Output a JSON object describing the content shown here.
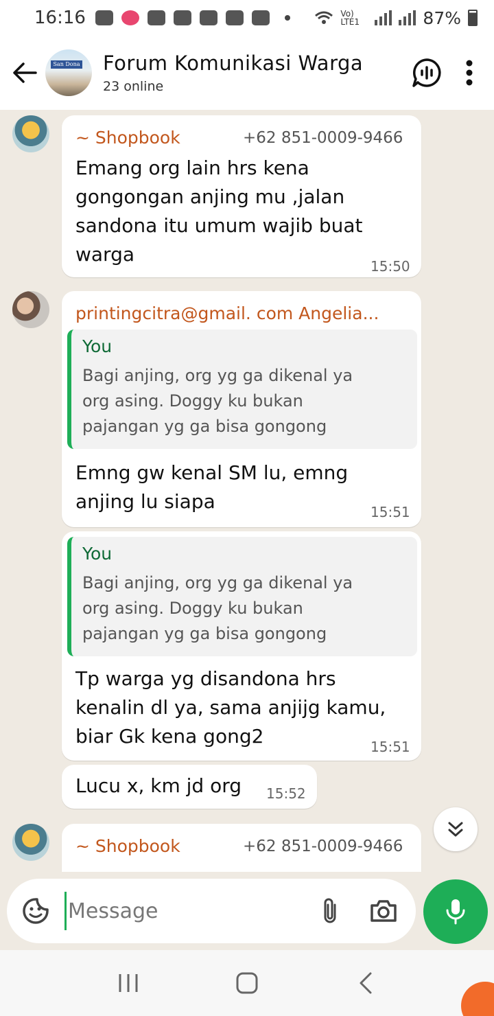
{
  "status_bar": {
    "time": "16:16",
    "network_label": "Vo) LTE1",
    "battery_percent": "87%"
  },
  "header": {
    "title": "Forum Komunikasi Warga",
    "subtitle": "23 online",
    "avatar_text": "San Dona"
  },
  "messages": [
    {
      "sender": "~ Shopbook",
      "phone": "+62 851-0009-9466",
      "lines": [
        "Emang org lain hrs kena",
        "gongongan anjing mu ,jalan",
        "sandona itu umum wajib buat",
        "warga"
      ],
      "time": "15:50"
    },
    {
      "sender": "printingcitra@gmail. com Angelia...",
      "quote": {
        "author": "You",
        "lines": [
          "Bagi anjing, org yg ga dikenal ya",
          "org asing. Doggy ku bukan",
          "pajangan yg ga bisa gongong"
        ]
      },
      "lines": [
        "Emng gw kenal SM lu, emng",
        "anjing lu siapa"
      ],
      "time": "15:51"
    },
    {
      "quote": {
        "author": "You",
        "lines": [
          "Bagi anjing, org yg ga dikenal ya",
          "org asing. Doggy ku bukan",
          "pajangan yg ga bisa gongong"
        ]
      },
      "lines": [
        "Tp warga yg disandona hrs",
        "kenalin dl ya, sama anjijg kamu,",
        "biar Gk kena gong2"
      ],
      "time": "15:51"
    },
    {
      "lines": [
        "Lucu x, km jd org"
      ],
      "time": "15:52"
    },
    {
      "sender": "~ Shopbook",
      "phone": "+62 851-0009-9466"
    }
  ],
  "input": {
    "placeholder": "Message"
  },
  "colors": {
    "accent_green": "#1eae57",
    "sender_orange": "#c2571d",
    "chat_background": "#efeae2"
  }
}
